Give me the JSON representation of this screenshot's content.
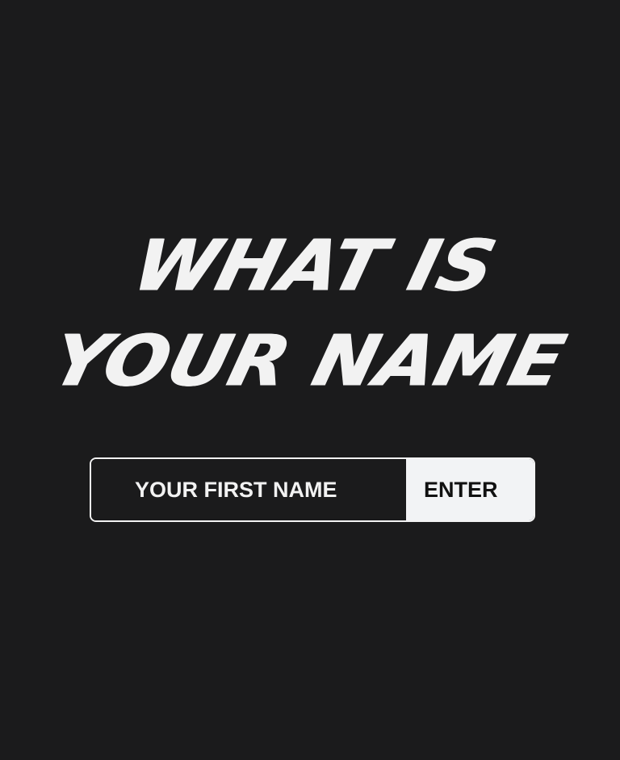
{
  "headline": {
    "line1": "WHAT IS",
    "line2": "YOUR NAME"
  },
  "form": {
    "name_placeholder": "YOUR FIRST NAME",
    "name_value": "",
    "enter_label": "ENTER"
  },
  "colors": {
    "background": "#1b1b1c",
    "foreground": "#f2f2f2",
    "button_background": "#f2f3f5",
    "button_text": "#111111"
  }
}
